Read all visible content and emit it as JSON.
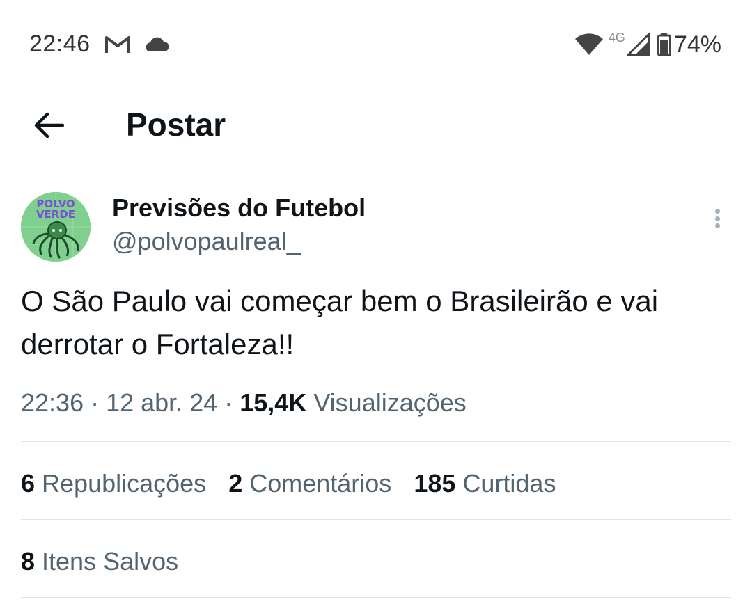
{
  "status_bar": {
    "time": "22:46",
    "network": "4G",
    "battery": "74%",
    "icons": [
      "gmail-icon",
      "cloud-icon",
      "wifi-icon",
      "signal-icon",
      "battery-icon"
    ]
  },
  "header": {
    "back_icon": "arrow-left-icon",
    "title": "Postar"
  },
  "post": {
    "author_name": "Previsões do Futebol",
    "author_handle": "@polvopaulreal_",
    "avatar_text_line1": "POLVO",
    "avatar_text_line2": "VERDE",
    "text": "O São Paulo vai começar bem o Brasileirão e vai derrotar o Fortaleza!!",
    "time": "22:36",
    "sep1": " · ",
    "date": "12 abr. 24",
    "sep2": " · ",
    "views_count": "15,4K",
    "views_label": " Visualizações"
  },
  "stats": {
    "reposts_count": "6",
    "reposts_label": " Republicações",
    "comments_count": "2",
    "comments_label": " Comentários",
    "likes_count": "185",
    "likes_label": " Curtidas",
    "saved_count": "8",
    "saved_label": " Itens Salvos"
  },
  "colors": {
    "text_primary": "#0f1419",
    "text_secondary": "#536471",
    "divider": "#e1e6ea",
    "avatar_bg": "#7fd08f",
    "avatar_text": "#7b4fd6"
  }
}
